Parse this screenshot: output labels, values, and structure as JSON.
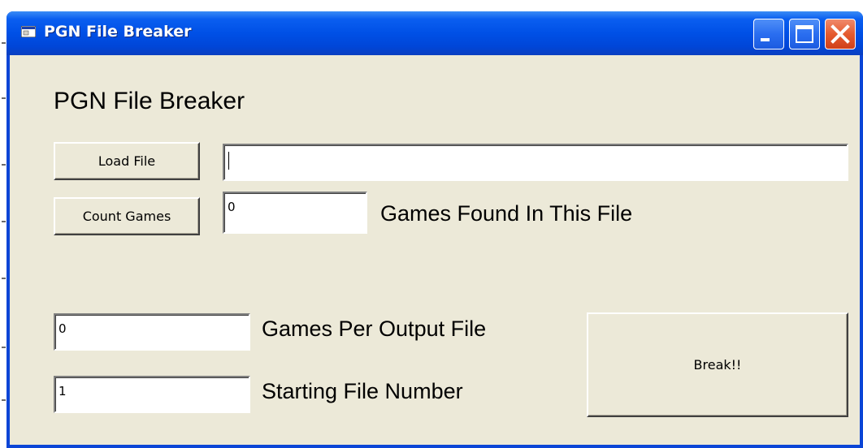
{
  "window": {
    "title": "PGN File Breaker",
    "colors": {
      "titlebar": "#0050e6",
      "client": "#ece9d8",
      "close": "#e55b2f"
    }
  },
  "content": {
    "heading": "PGN File Breaker",
    "load_file_button": "Load File",
    "file_path_value": "",
    "count_games_button": "Count Games",
    "games_found_value": "0",
    "games_found_label": "Games Found In This File",
    "games_per_output_value": "0",
    "games_per_output_label": "Games Per Output File",
    "starting_file_value": "1",
    "starting_file_label": "Starting File Number",
    "break_button": "Break!!"
  },
  "icons": {
    "app": "window-app-icon",
    "minimize": "minimize-icon",
    "maximize": "maximize-icon",
    "close": "close-icon"
  }
}
